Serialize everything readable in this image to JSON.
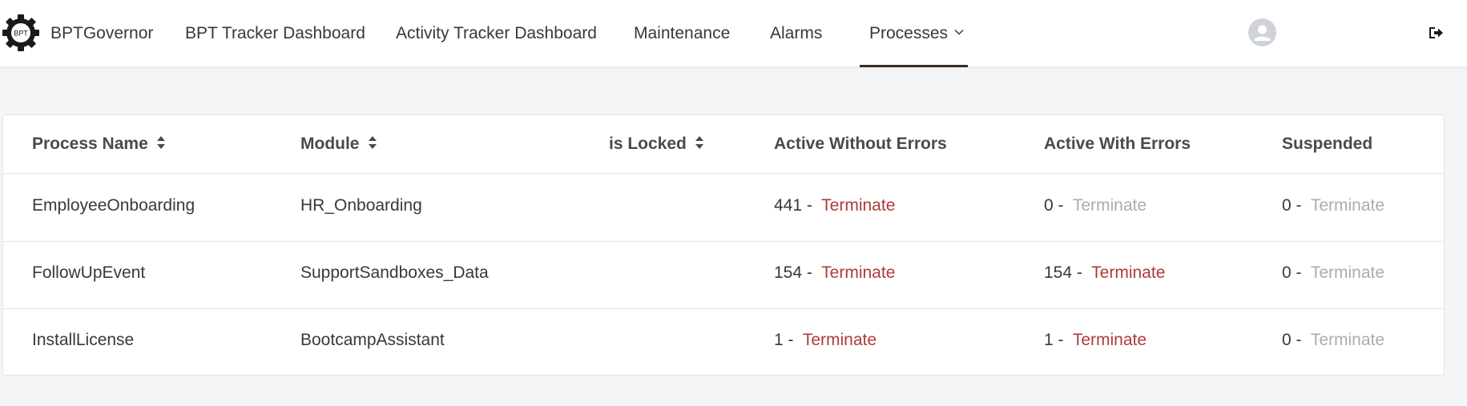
{
  "app": {
    "logo_text": "BPT",
    "brand": "BPTGovernor"
  },
  "nav": {
    "items": [
      {
        "label": "BPT Tracker Dashboard"
      },
      {
        "label": "Activity Tracker Dashboard"
      },
      {
        "label": "Maintenance"
      },
      {
        "label": "Alarms"
      },
      {
        "label": "Processes",
        "active": true,
        "has_dropdown": true
      }
    ]
  },
  "header_icons": [
    "user-avatar-icon",
    "logout-icon"
  ],
  "table": {
    "columns": [
      {
        "label": "Process Name",
        "sortable": true
      },
      {
        "label": "Module",
        "sortable": true
      },
      {
        "label": "is Locked",
        "sortable": true
      },
      {
        "label": "Active Without Errors",
        "sortable": false
      },
      {
        "label": "Active With Errors",
        "sortable": false
      },
      {
        "label": "Suspended",
        "sortable": false
      }
    ],
    "action_label": "Terminate",
    "rows": [
      {
        "process": "EmployeeOnboarding",
        "module": "HR_Onboarding",
        "locked": "",
        "active_without_errors": "441 -",
        "active_with_errors": "0 -",
        "suspended": "0 -",
        "awe_enabled": true,
        "awerr_enabled": false,
        "susp_enabled": false
      },
      {
        "process": "FollowUpEvent",
        "module": "SupportSandboxes_Data",
        "locked": "",
        "active_without_errors": "154 -",
        "active_with_errors": "154 -",
        "suspended": "0 -",
        "awe_enabled": true,
        "awerr_enabled": true,
        "susp_enabled": false
      },
      {
        "process": "InstallLicense",
        "module": "BootcampAssistant",
        "locked": "",
        "active_without_errors": "1 -",
        "active_with_errors": "1 -",
        "suspended": "0 -",
        "awe_enabled": true,
        "awerr_enabled": true,
        "susp_enabled": false
      }
    ]
  },
  "colors": {
    "terminate_enabled": "#b03a3a",
    "terminate_disabled": "#a8adb3",
    "active_tab_bar": "#3b2a24",
    "background": "#f3f5f7"
  }
}
